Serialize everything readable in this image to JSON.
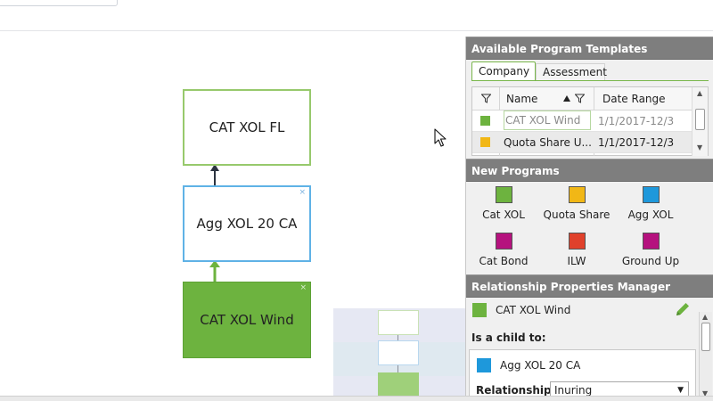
{
  "canvas": {
    "nodes": [
      {
        "label": "CAT XOL FL",
        "color": "#97c96c"
      },
      {
        "label": "Agg XOL 20 CA",
        "color": "#5fb2e6"
      },
      {
        "label": "CAT XOL Wind",
        "color": "#6db33f"
      }
    ],
    "node_close_glyph": "×"
  },
  "panel": {
    "templates_header": "Available Program Templates",
    "tabs": [
      "Company",
      "Assessment"
    ],
    "grid": {
      "columns": [
        "Name",
        "Date Range"
      ],
      "rows": [
        {
          "name": "CAT XOL Wind",
          "date_range": "1/1/2017-12/3",
          "color": "#6db33f"
        },
        {
          "name": "Quota Share U...",
          "date_range": "1/1/2017-12/3",
          "color": "#f1b716"
        }
      ]
    },
    "new_programs_header": "New Programs",
    "new_programs": [
      {
        "label": "Cat XOL",
        "color": "#6db33f"
      },
      {
        "label": "Quota Share",
        "color": "#f1b716"
      },
      {
        "label": "Agg XOL",
        "color": "#1e98db"
      },
      {
        "label": "Cat Bond",
        "color": "#b5127e"
      },
      {
        "label": "ILW",
        "color": "#e0412b"
      },
      {
        "label": "Ground Up",
        "color": "#b5127e"
      }
    ],
    "relationship": {
      "header": "Relationship Properties Manager",
      "selected": "CAT XOL Wind",
      "child_label": "Is a child to:",
      "parent": "Agg XOL 20 CA",
      "relationship_label": "Relationship",
      "relationship_value": "Inuring"
    }
  },
  "icons": [
    "filter-icon",
    "sort-up-icon",
    "edit-pencil-icon",
    "dropdown-caret-icon",
    "mouse-cursor-icon"
  ]
}
